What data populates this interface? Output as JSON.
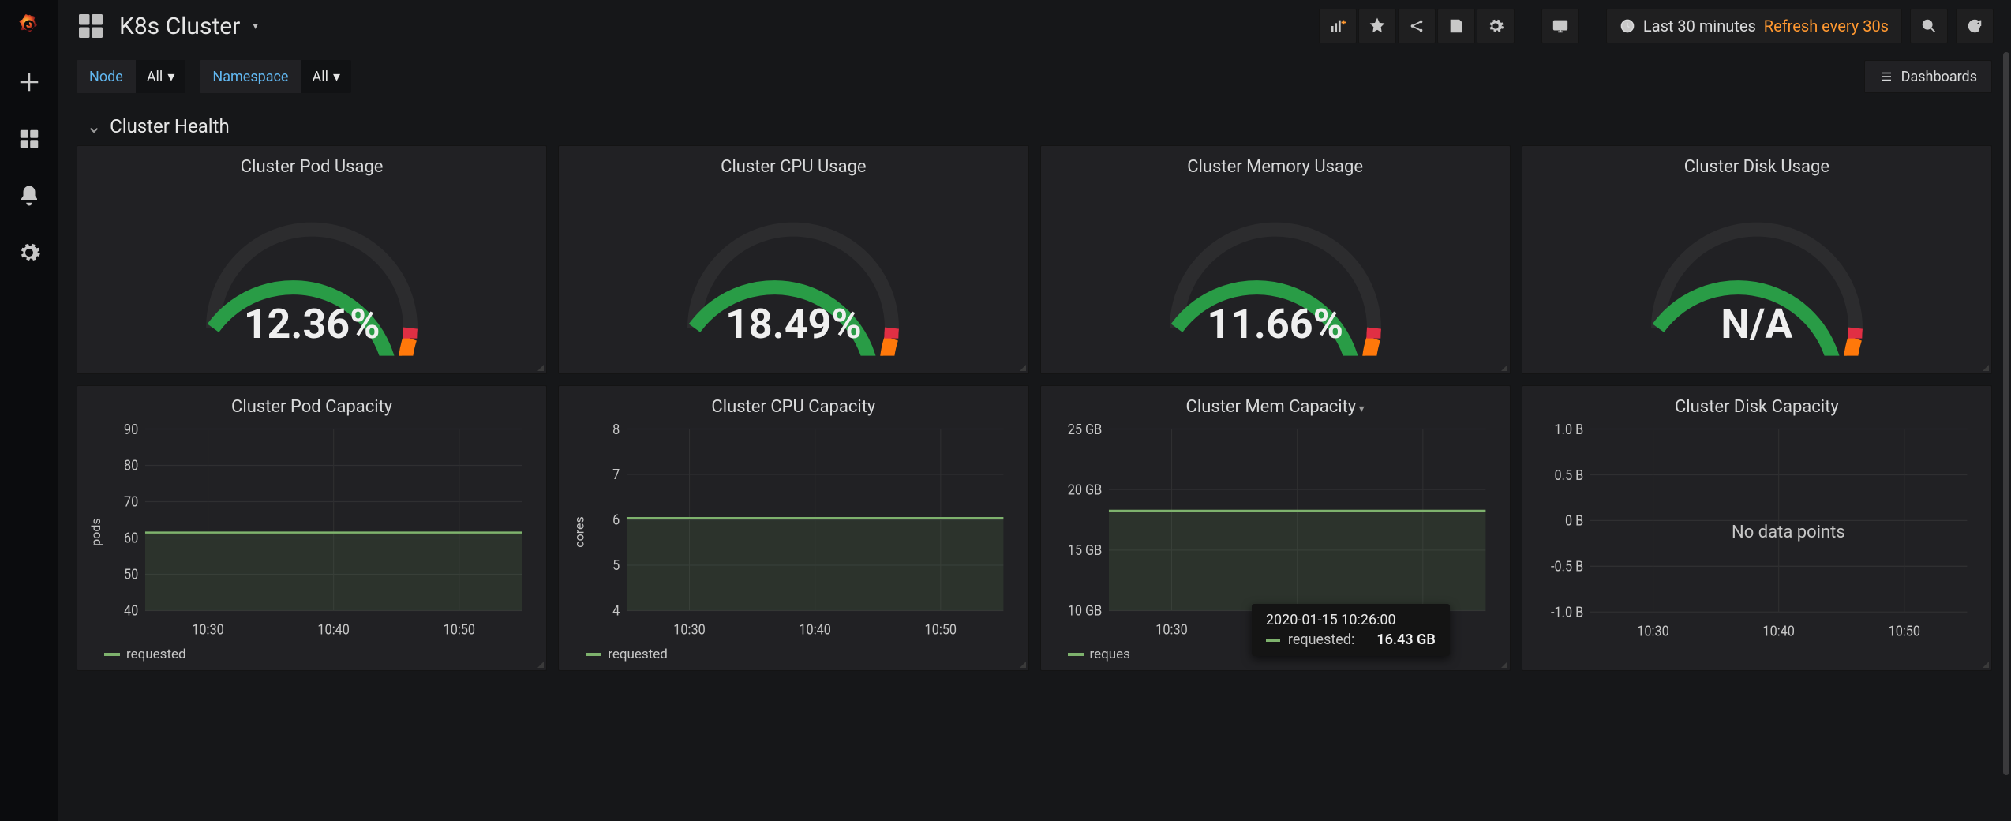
{
  "header": {
    "title": "K8s Cluster",
    "time_range": "Last 30 minutes",
    "refresh": "Refresh every 30s"
  },
  "sidebar": {
    "items": [
      "logo",
      "add",
      "dashboards",
      "alerts",
      "settings"
    ]
  },
  "variables": [
    {
      "label": "Node",
      "value": "All"
    },
    {
      "label": "Namespace",
      "value": "All"
    }
  ],
  "dash_link": "Dashboards",
  "row_title": "Cluster Health",
  "gauges": [
    {
      "title": "Cluster Pod Usage",
      "value": "12.36%",
      "pct": 12.36
    },
    {
      "title": "Cluster CPU Usage",
      "value": "18.49%",
      "pct": 18.49
    },
    {
      "title": "Cluster Memory Usage",
      "value": "11.66%",
      "pct": 11.66
    },
    {
      "title": "Cluster Disk Usage",
      "value": "N/A",
      "pct": null
    }
  ],
  "charts": [
    {
      "title": "Cluster Pod Capacity",
      "ylabel": "pods",
      "yticks": [
        "90",
        "80",
        "70",
        "60",
        "50",
        "40"
      ],
      "xticks": [
        "10:30",
        "10:40",
        "10:50"
      ],
      "legend": "requested",
      "line_y_frac": 0.57,
      "fill": true,
      "has_caret": false
    },
    {
      "title": "Cluster CPU Capacity",
      "ylabel": "cores",
      "yticks": [
        "8",
        "7",
        "6",
        "5",
        "4"
      ],
      "xticks": [
        "10:30",
        "10:40",
        "10:50"
      ],
      "legend": "requested",
      "line_y_frac": 0.49,
      "fill": true,
      "has_caret": false
    },
    {
      "title": "Cluster Mem Capacity",
      "ylabel": "",
      "yticks": [
        "25 GB",
        "20 GB",
        "15 GB",
        "10 GB"
      ],
      "xticks": [
        "10:30",
        "10:40",
        "10:50"
      ],
      "legend": "reques",
      "line_y_frac": 0.45,
      "fill": true,
      "has_caret": true
    },
    {
      "title": "Cluster Disk Capacity",
      "ylabel": "",
      "yticks": [
        "1.0 B",
        "0.5 B",
        "0 B",
        "-0.5 B",
        "-1.0 B"
      ],
      "xticks": [
        "10:30",
        "10:40",
        "10:50"
      ],
      "legend": null,
      "nodata": "No data points",
      "has_caret": false
    }
  ],
  "tooltip": {
    "timestamp": "2020-01-15 10:26:00",
    "series": "requested:",
    "value": "16.43 GB"
  },
  "chart_data": [
    {
      "type": "line",
      "panel": "Cluster Pod Capacity",
      "x": [
        "10:25",
        "10:30",
        "10:35",
        "10:40",
        "10:45",
        "10:50",
        "10:55"
      ],
      "series": [
        {
          "name": "requested",
          "values": [
            62,
            62,
            62,
            62,
            62,
            62,
            62
          ]
        }
      ],
      "ylabel": "pods",
      "ylim": [
        40,
        90
      ]
    },
    {
      "type": "line",
      "panel": "Cluster CPU Capacity",
      "x": [
        "10:25",
        "10:30",
        "10:35",
        "10:40",
        "10:45",
        "10:50",
        "10:55"
      ],
      "series": [
        {
          "name": "requested",
          "values": [
            6.0,
            6.0,
            6.0,
            6.0,
            6.0,
            6.0,
            6.0
          ]
        }
      ],
      "ylabel": "cores",
      "ylim": [
        4,
        8
      ]
    },
    {
      "type": "line",
      "panel": "Cluster Mem Capacity",
      "x": [
        "10:25",
        "10:30",
        "10:35",
        "10:40",
        "10:45",
        "10:50",
        "10:55"
      ],
      "series": [
        {
          "name": "requested",
          "values": [
            16.43,
            16.43,
            16.43,
            16.43,
            16.43,
            16.43,
            16.43
          ]
        }
      ],
      "ylabel": "GB",
      "ylim": [
        10,
        25
      ]
    },
    {
      "type": "line",
      "panel": "Cluster Disk Capacity",
      "x": [
        "10:30",
        "10:40",
        "10:50"
      ],
      "series": [],
      "ylabel": "B",
      "ylim": [
        -1.0,
        1.0
      ],
      "note": "No data points"
    }
  ]
}
